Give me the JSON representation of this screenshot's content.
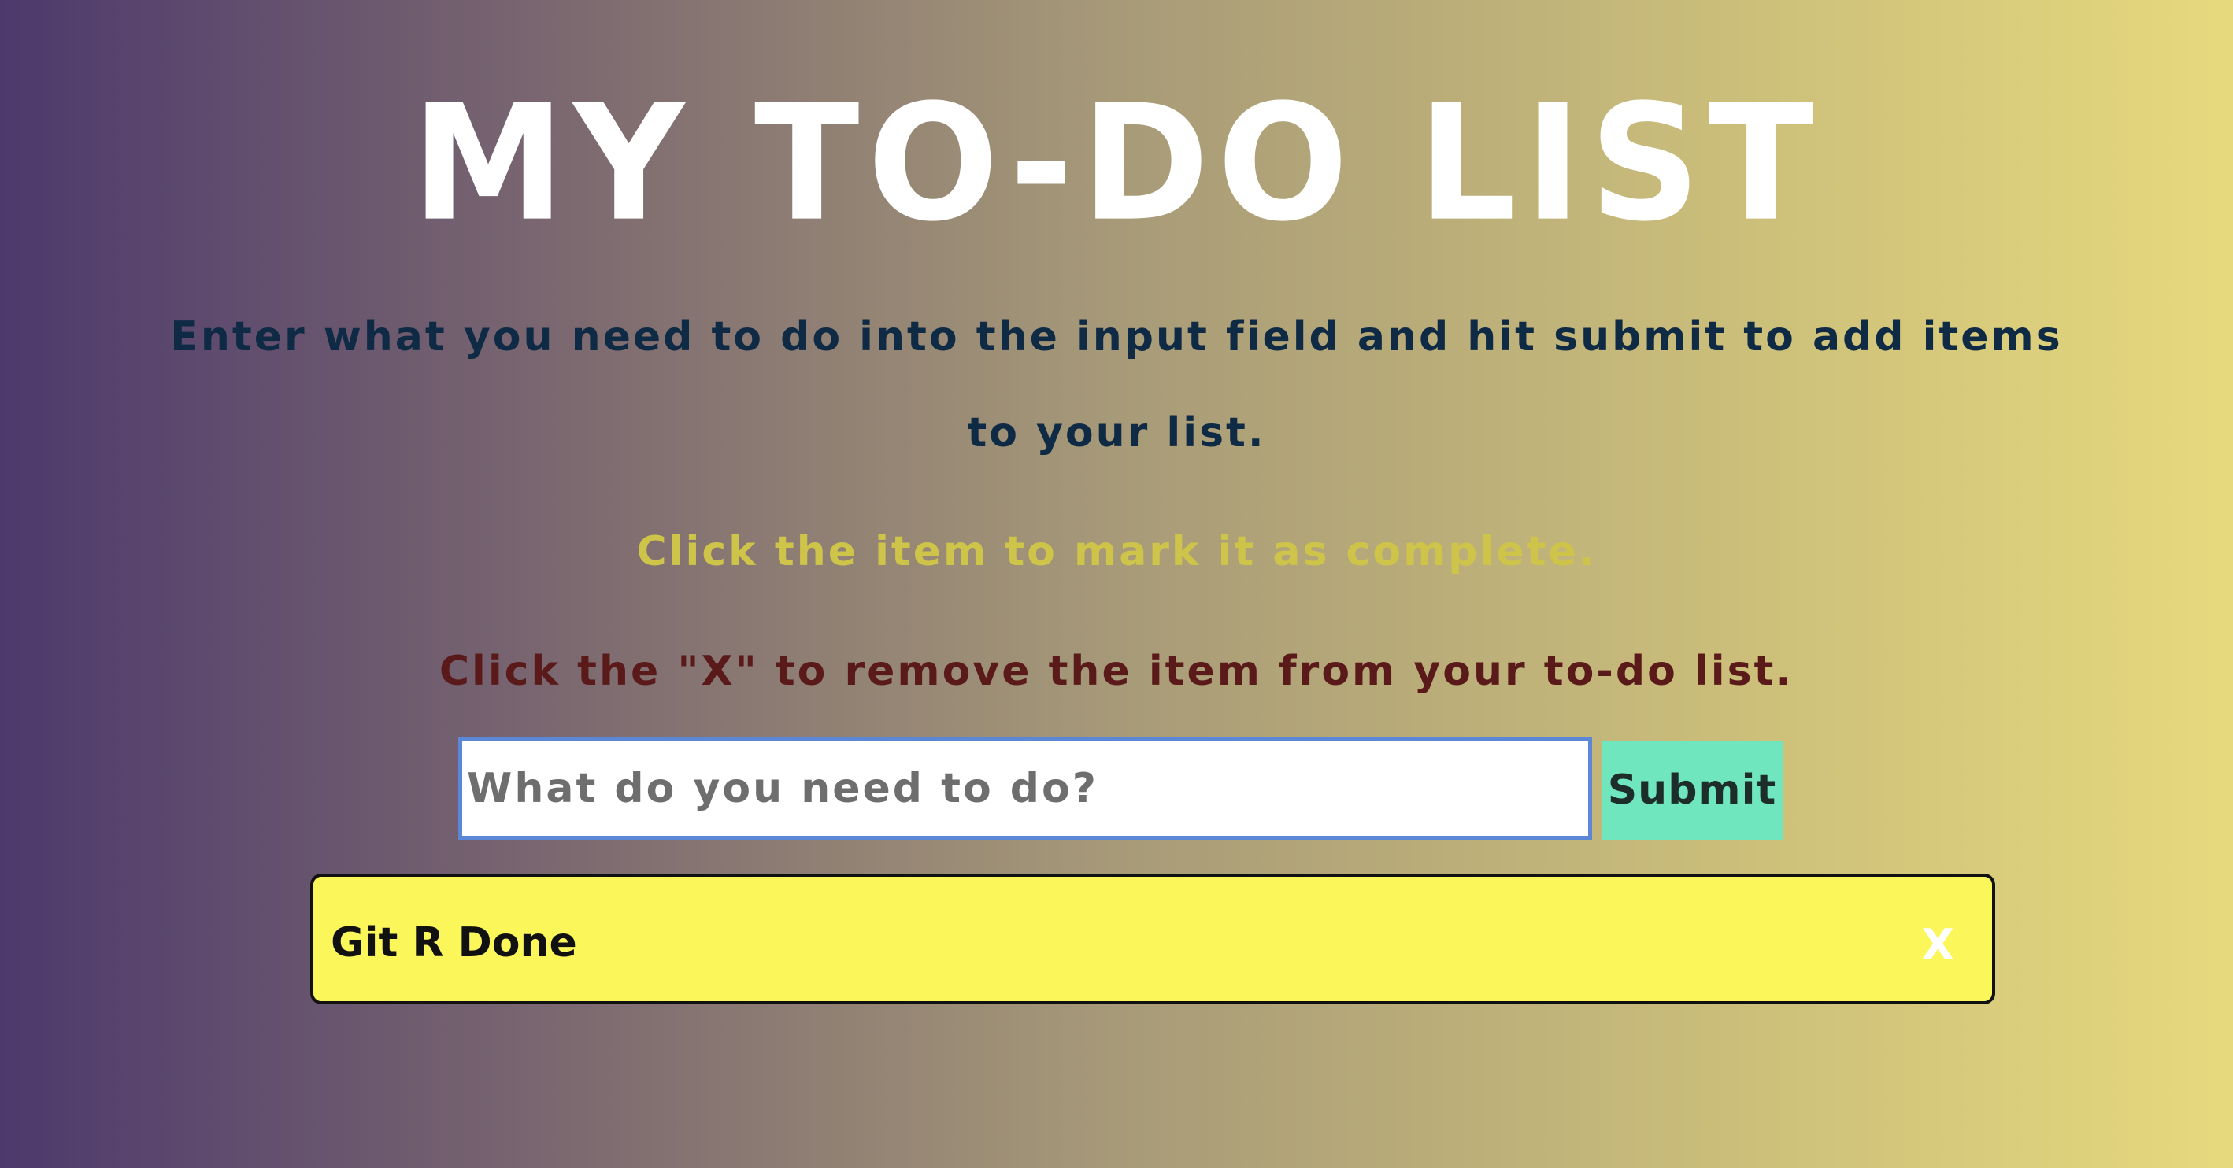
{
  "header": {
    "title": "MY TO-DO LIST"
  },
  "instructions": {
    "line1": "Enter what you need to do into the input field and hit submit to add items",
    "line2": "to your list.",
    "line3": "Click the item to mark it as complete.",
    "line4": "Click the \"X\" to remove the item from your to-do list."
  },
  "form": {
    "placeholder": "What do you need to do?",
    "value": "",
    "submit_label": "Submit"
  },
  "todos": [
    {
      "text": "Git R Done",
      "remove_label": "X"
    }
  ],
  "colors": {
    "title": "#ffffff",
    "instruction_main": "#0e2a45",
    "instruction_complete": "#cfc44a",
    "instruction_remove": "#5a1a1a",
    "submit_bg": "#6fe6bd",
    "todo_bg": "#fbf65a",
    "input_border": "#5b87d6"
  }
}
